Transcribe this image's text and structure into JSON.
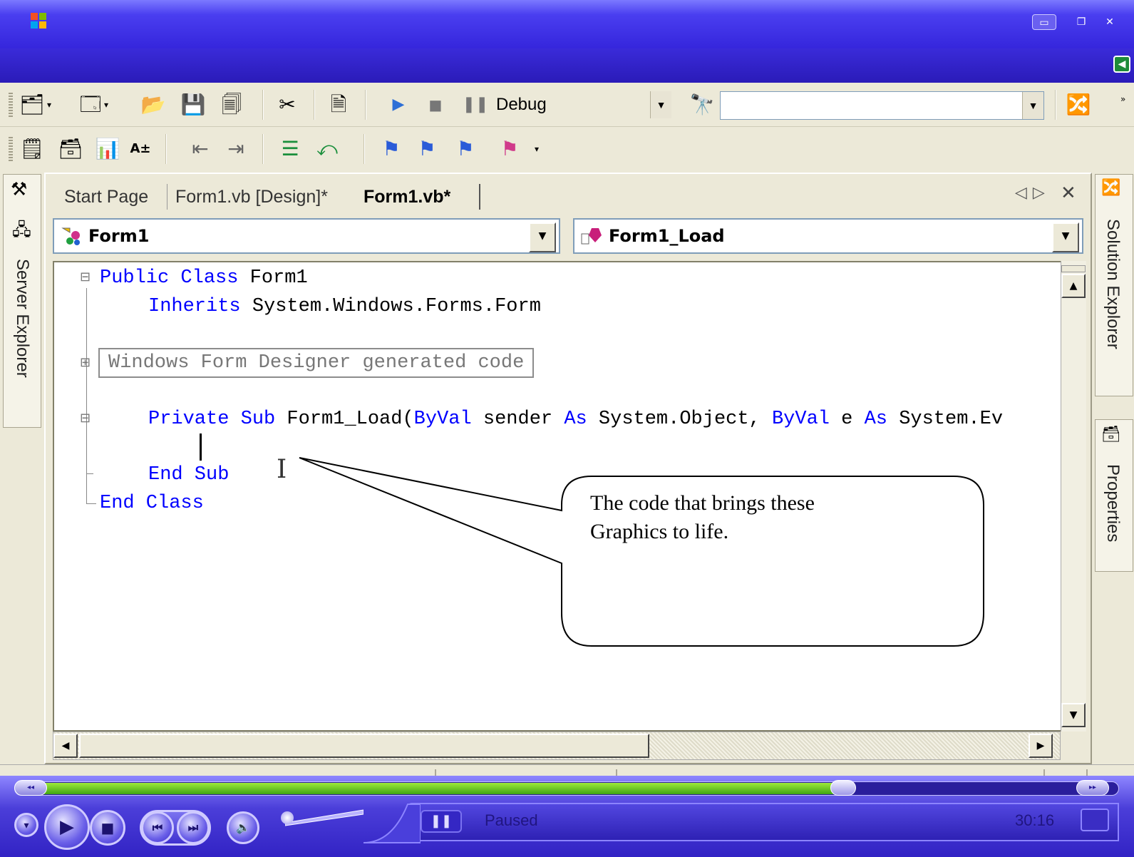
{
  "toolbar": {
    "config_value": "Debug",
    "platform_value": ""
  },
  "left_panel": {
    "server_explorer_label": "Server Explorer"
  },
  "right_panel": {
    "solution_explorer_label": "Solution Explorer",
    "properties_label": "Properties"
  },
  "tabs": [
    {
      "label": "Start Page",
      "active": false
    },
    {
      "label": "Form1.vb [Design]*",
      "active": false
    },
    {
      "label": "Form1.vb*",
      "active": true
    }
  ],
  "dropdowns": {
    "class_name": "Form1",
    "method_name": "Form1_Load"
  },
  "code": {
    "line1_kw": "Public Class",
    "line1_rest": " Form1",
    "line2_kw": "Inherits",
    "line2_rest": " System.Windows.Forms.Form",
    "region_label": "Windows Form Designer generated code",
    "line4_kw1": "Private Sub",
    "line4_a": " Form1_Load(",
    "line4_kw2": "ByVal",
    "line4_b": " sender ",
    "line4_kw3": "As",
    "line4_c": " System.Object, ",
    "line4_kw4": "ByVal",
    "line4_d": " e ",
    "line4_kw5": "As",
    "line4_e": " System.Ev",
    "end_sub": "End Sub",
    "end_class": "End Class"
  },
  "callout": {
    "text_line1": "The code that brings these",
    "text_line2": "Graphics to life."
  },
  "player": {
    "status": "Paused",
    "time": "30:16",
    "progress": 0.75
  },
  "colors": {
    "keyword": "#0000ff",
    "title_bar": "#3526dc",
    "seek_fill": "#5fc420"
  }
}
